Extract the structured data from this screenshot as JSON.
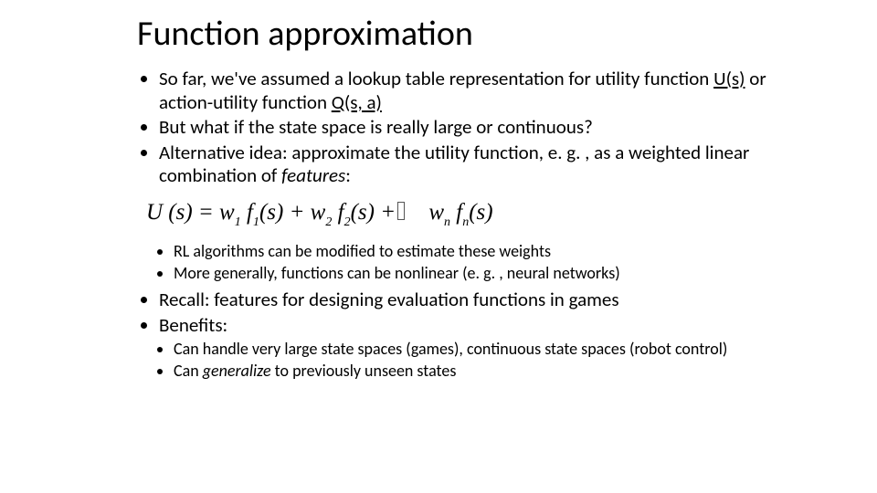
{
  "title": "Function approximation",
  "bullets": {
    "b1_a": "So far, we've assumed a lookup table representation for utility function ",
    "b1_u1": "U(s)",
    "b1_b": " or action-utility function ",
    "b1_u2": "Q(s, a)",
    "b2": "But what if the state space is really large or continuous?",
    "b3_a": "Alternative idea: approximate the utility function, e. g. , as a weighted linear combination of ",
    "b3_i": "features",
    "b3_b": ":",
    "sub1_a": "RL algorithms can be modified to estimate these weights",
    "sub1_b": "More generally, functions can be nonlinear (e. g. , neural networks)",
    "b4": "Recall: features for designing evaluation functions in games",
    "b5": "Benefits:",
    "sub2_a": "Can handle very large state spaces (games), continuous state spaces (robot control)",
    "sub2_b_a": "Can ",
    "sub2_b_i": "generalize",
    "sub2_b_b": " to previously unseen states"
  },
  "formula": {
    "lhs": "U (s) = w",
    "s1": "1",
    "f1": " f",
    "s1b": "1",
    "arg1": "(s) + w",
    "s2": "2",
    "f2": " f",
    "s2b": "2",
    "arg2": "(s) +",
    "wn": " w",
    "sn": "n",
    "fn": " f",
    "snb": "n",
    "argn": "(s)"
  }
}
